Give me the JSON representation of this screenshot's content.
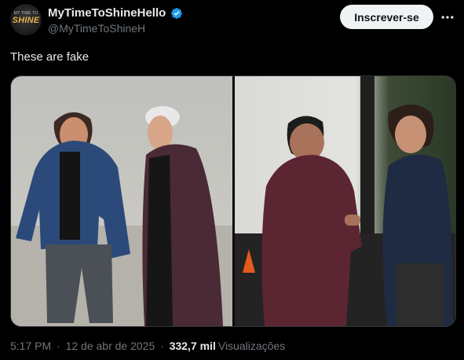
{
  "author": {
    "display_name": "MyTimeToShineHello",
    "handle": "@MyTimeToShineH",
    "avatar_text_top": "MY TIME TO",
    "avatar_text_main": "SHINE",
    "verified_icon": "verified-badge-icon",
    "verified_color": "#1d9bf0"
  },
  "actions": {
    "subscribe_label": "Inscrever-se",
    "more_icon": "more-options-icon"
  },
  "tweet": {
    "text": "These are fake"
  },
  "media": {
    "left_photo": "two-men-walking-photo",
    "right_photo": "two-men-talking-photo"
  },
  "meta": {
    "time": "5:17 PM",
    "separator": "·",
    "date": "12 de abr de 2025",
    "views_count": "332,7 mil",
    "views_label": "Visualizações"
  },
  "colors": {
    "background": "#000000",
    "text_primary": "#e7e9ea",
    "text_secondary": "#71767b",
    "button_bg": "#eff3f4",
    "border": "#2f3336"
  }
}
